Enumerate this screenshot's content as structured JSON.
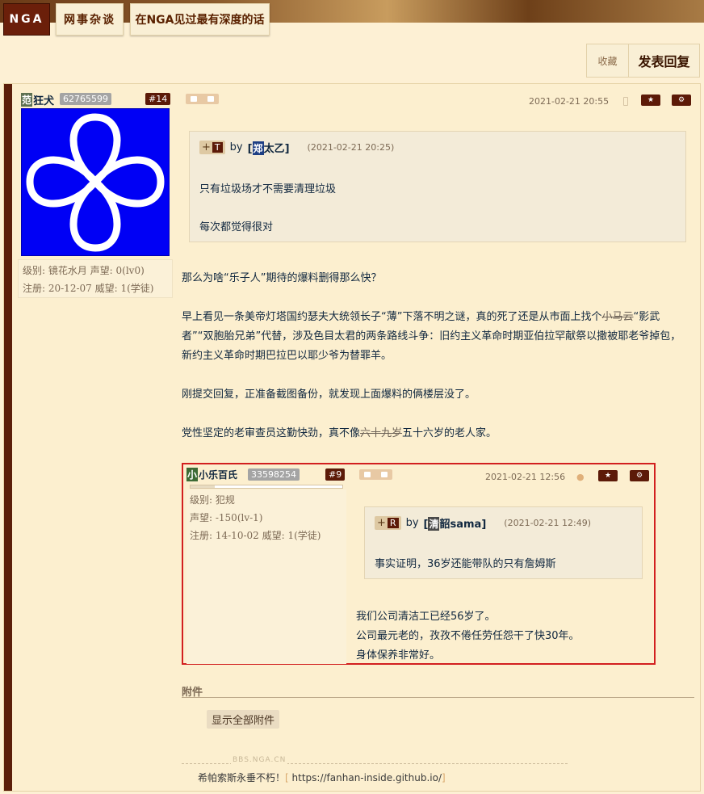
{
  "header": {
    "logo": "NGA",
    "board": "网事杂谈",
    "thread_title": "在NGA见过最有深度的话"
  },
  "actions": {
    "favorite": "收藏",
    "reply": "发表回复"
  },
  "post": {
    "user": {
      "badge": "范",
      "name": "狂犬",
      "uid": "62765599",
      "level_line": "级别: 镜花水月   声望: 0(lv0)",
      "reg_line": "注册: 20-12-07  威望: 1(学徒)"
    },
    "floor": "#14",
    "date": "2021-02-21 20:55",
    "quote": {
      "tag_plus": "+",
      "tag_letter": "T",
      "by": "by",
      "user_badge": "郑",
      "user_name": "太乙",
      "date": "(2021-02-21 20:25)",
      "line1": "只有垃圾场才不需要清理垃圾",
      "line2": "每次都觉得很对"
    },
    "para1": "那么为啥“乐子人”期待的爆料删得那么快？",
    "para2_a": "早上看见一条美帝灯塔国约瑟夫大统领长子“薄”下落不明之谜，真的死了还是从市面上找个",
    "para2_strike": "小马云",
    "para2_b": "“影武者”“双胞胎兄弟”代替，涉及色目太君的两条路线斗争：旧约主义革命时期亚伯拉罕献祭以撒被耶老爷掉包，新约主义革命时期巴拉巴以耶少爷为替罪羊。",
    "para3": "刚提交回复，正准备截图备份，就发现上面爆料的俩楼层没了。",
    "para4_a": "党性坚定的老审查员这勤快劲，真不像",
    "para4_strike": "六十九岁",
    "para4_b": "五十六岁的老人家。",
    "inner": {
      "user_badge": "小",
      "user_name": "小乐百氏",
      "uid": "33598254",
      "floor": "#9",
      "level": "级别: 犯规",
      "fame": "声望: -150(lv-1)",
      "reg": "注册: 14-10-02  威望: 1(学徒)",
      "date": "2021-02-21 12:56",
      "quote": {
        "tag_plus": "+",
        "tag_letter": "R",
        "by": "by",
        "user_badge": "清",
        "user_name": "韶sama",
        "date": "(2021-02-21 12:49)",
        "text": "事实证明，36岁还能带队的只有詹姆斯"
      },
      "line1": "我们公司清洁工已经56岁了。",
      "line2": "公司最元老的，孜孜不倦任劳任怨干了快30年。",
      "line3": "身体保养非常好。"
    },
    "attachments_title": "附件",
    "show_all_attachments": "显示全部附件",
    "watermark": "BBS.NGA.CN",
    "signature_text": "希帕索斯永垂不朽！",
    "signature_link": "https://fanhan-inside.github.io/"
  },
  "colors": {
    "background": "#fdf0d4",
    "accent": "#5c1a08",
    "highlight_border": "#d21f1f",
    "avatar_bg": "#0000f5"
  }
}
